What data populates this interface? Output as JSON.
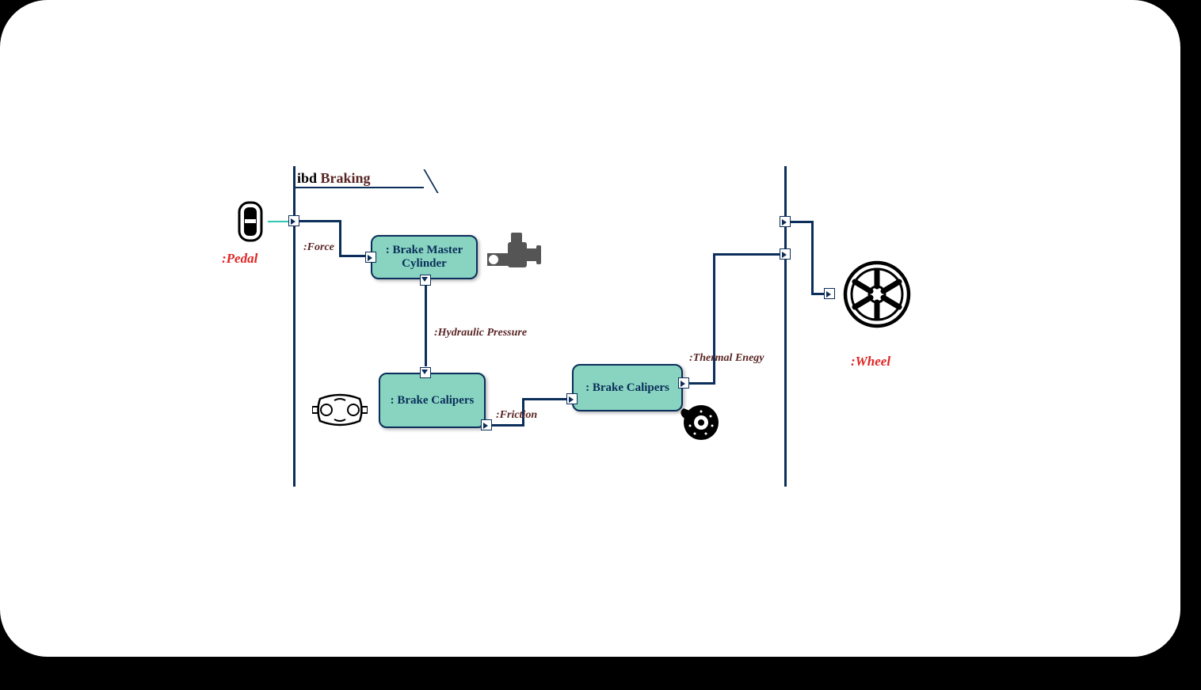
{
  "frame": {
    "prefix": "ibd",
    "name": "Braking"
  },
  "blocks": {
    "masterCylinder": ": Brake Master Cylinder",
    "calipers1": ": Brake Calipers",
    "calipers2": ": Brake Calipers"
  },
  "external": {
    "pedal": ":Pedal",
    "wheel": ":Wheel"
  },
  "flows": {
    "force": ":Force",
    "hydraulic": ":Hydraulic Pressure",
    "friction": ":Friction",
    "thermal": ":Thermal Enegy"
  }
}
